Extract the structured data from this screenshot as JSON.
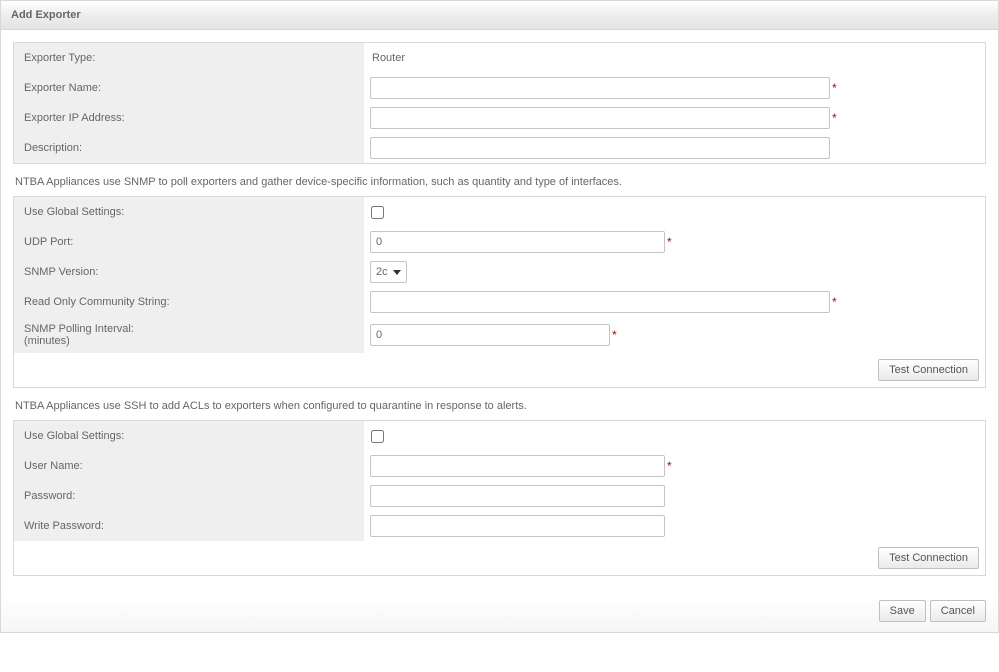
{
  "dialog": {
    "title": "Add Exporter"
  },
  "section1": {
    "exporterTypeLabel": "Exporter Type:",
    "exporterTypeValue": "Router",
    "exporterNameLabel": "Exporter Name:",
    "exporterNameValue": "",
    "exporterIpLabel": "Exporter IP Address:",
    "exporterIpValue": "",
    "descriptionLabel": "Description:",
    "descriptionValue": ""
  },
  "snmpInfo": "NTBA Appliances use SNMP to poll exporters and gather device-specific information, such as quantity and type of interfaces.",
  "section2": {
    "useGlobalLabel": "Use Global Settings:",
    "useGlobalChecked": false,
    "udpPortLabel": "UDP Port:",
    "udpPortValue": "0",
    "snmpVersionLabel": "SNMP Version:",
    "snmpVersionValue": "2c",
    "communityLabel": "Read Only Community String:",
    "communityValue": "",
    "pollingLabel1": "SNMP Polling Interval:",
    "pollingLabel2": "(minutes)",
    "pollingValue": "0",
    "testConnectionLabel": "Test Connection"
  },
  "sshInfo": "NTBA Appliances use SSH to add ACLs to exporters when configured to quarantine in response to alerts.",
  "section3": {
    "useGlobalLabel": "Use Global Settings:",
    "useGlobalChecked": false,
    "userNameLabel": "User Name:",
    "userNameValue": "",
    "passwordLabel": "Password:",
    "passwordValue": "",
    "writePasswordLabel": "Write Password:",
    "writePasswordValue": "",
    "testConnectionLabel": "Test Connection"
  },
  "footer": {
    "saveLabel": "Save",
    "cancelLabel": "Cancel"
  }
}
